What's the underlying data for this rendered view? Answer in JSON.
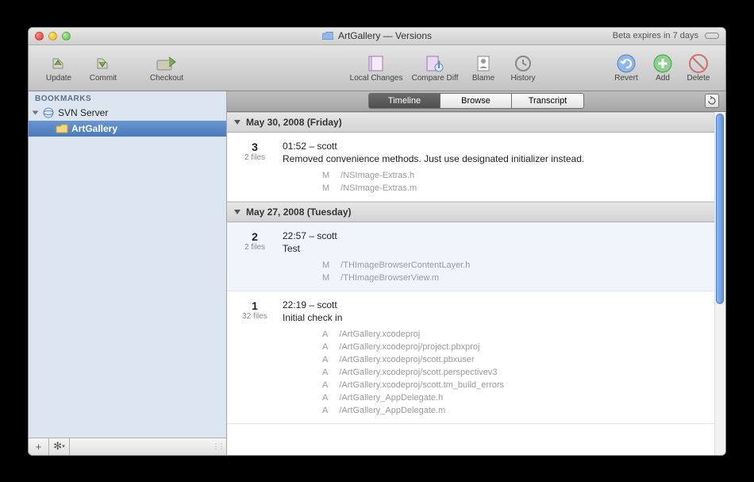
{
  "title": {
    "folder": "ArtGallery",
    "app": "Versions",
    "full": "ArtGallery — Versions"
  },
  "beta_notice": "Beta expires in 7 days",
  "toolbar": {
    "update": "Update",
    "commit": "Commit",
    "checkout": "Checkout",
    "local_changes": "Local Changes",
    "compare_diff": "Compare Diff",
    "blame": "Blame",
    "history": "History",
    "revert": "Revert",
    "add": "Add",
    "delete": "Delete"
  },
  "sidebar": {
    "header": "BOOKMARKS",
    "server": "SVN Server",
    "selected_repo": "ArtGallery"
  },
  "tabs": {
    "timeline": "Timeline",
    "browse": "Browse",
    "transcript": "Transcript"
  },
  "days": [
    {
      "label": "May 30, 2008 (Friday)",
      "commits": [
        {
          "rev": "3",
          "filecount": "2 files",
          "meta": "01:52 – scott",
          "msg": "Removed convenience methods. Just use designated initializer instead.",
          "files": [
            {
              "s": "M",
              "p": "/NSImage-Extras.h"
            },
            {
              "s": "M",
              "p": "/NSImage-Extras.m"
            }
          ]
        }
      ]
    },
    {
      "label": "May 27, 2008 (Tuesday)",
      "commits": [
        {
          "rev": "2",
          "filecount": "2 files",
          "meta": "22:57 – scott",
          "msg": "Test",
          "highlighted": true,
          "files": [
            {
              "s": "M",
              "p": "/THImageBrowserContentLayer.h"
            },
            {
              "s": "M",
              "p": "/THImageBrowserView.m"
            }
          ]
        },
        {
          "rev": "1",
          "filecount": "32 files",
          "meta": "22:19 – scott",
          "msg": "Initial check in",
          "files": [
            {
              "s": "A",
              "p": "/ArtGallery.xcodeproj"
            },
            {
              "s": "A",
              "p": "/ArtGallery.xcodeproj/project.pbxproj"
            },
            {
              "s": "A",
              "p": "/ArtGallery.xcodeproj/scott.pbxuser"
            },
            {
              "s": "A",
              "p": "/ArtGallery.xcodeproj/scott.perspectivev3"
            },
            {
              "s": "A",
              "p": "/ArtGallery.xcodeproj/scott.tm_build_errors"
            },
            {
              "s": "A",
              "p": "/ArtGallery_AppDelegate.h"
            },
            {
              "s": "A",
              "p": "/ArtGallery_AppDelegate.m"
            }
          ]
        }
      ]
    }
  ]
}
